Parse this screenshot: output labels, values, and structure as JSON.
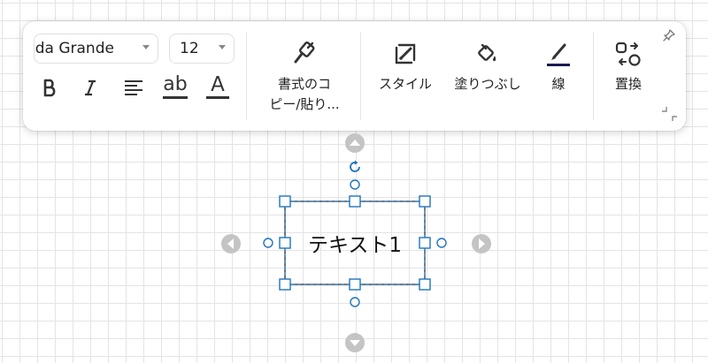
{
  "toolbar": {
    "font_family": "ida Grande",
    "font_size": "12",
    "format_painter_label_line1": "書式のコ",
    "format_painter_label_line2": "ピー/貼り...",
    "style_label": "スタイル",
    "fill_label": "塗りつぶし",
    "line_label": "線",
    "replace_label": "置換",
    "underline_glyph": "ab",
    "font_color_glyph": "A",
    "accent_color": "#1a1a50"
  },
  "canvas": {
    "shape_text": "テキスト1",
    "selection_color": "#1e73be",
    "arrow_color": "#c4c4c4"
  }
}
